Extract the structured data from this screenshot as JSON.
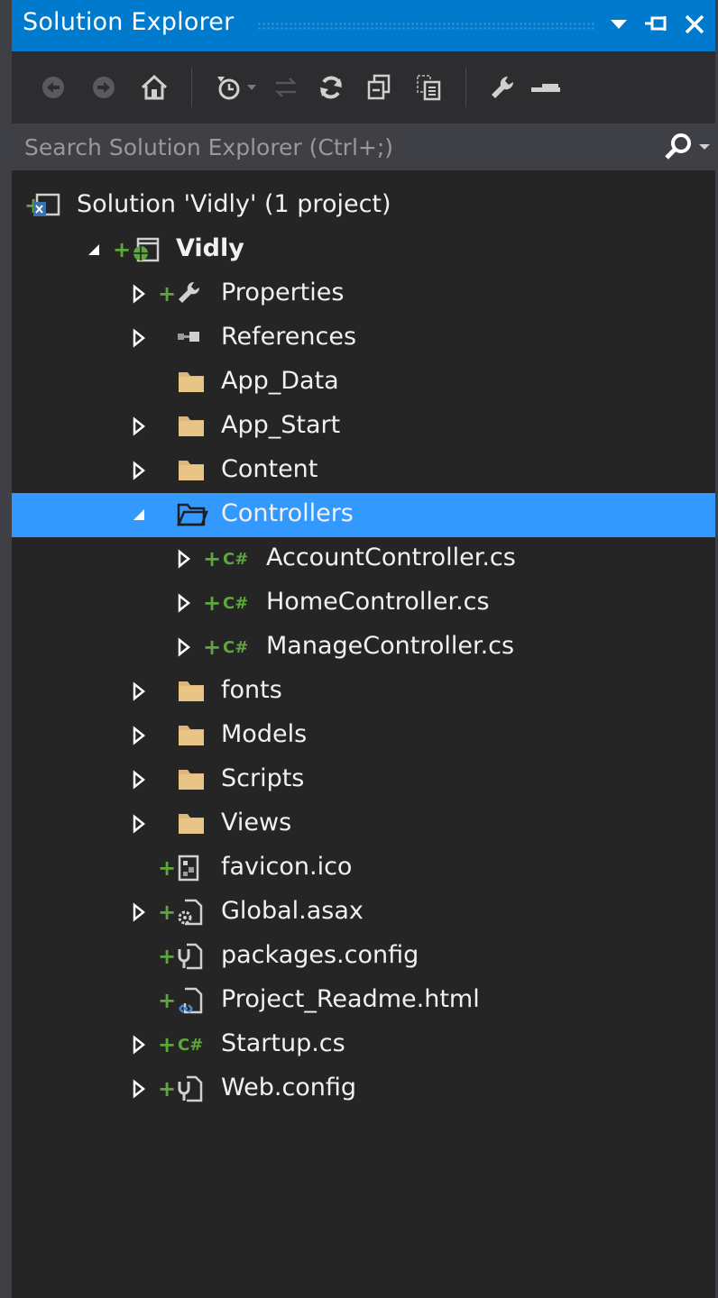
{
  "window": {
    "title": "Solution Explorer"
  },
  "titlebar_icons": [
    "dropdown-arrow-icon",
    "pin-icon",
    "close-icon"
  ],
  "toolbar": {
    "icons": [
      "back-icon",
      "forward-icon",
      "home-icon",
      "history-icon",
      "history-dropdown-icon",
      "sync-icon",
      "refresh-icon",
      "collapse-all-icon",
      "show-all-files-icon",
      "properties-wrench-icon",
      "preview-icon"
    ]
  },
  "search": {
    "placeholder": "Search Solution Explorer (Ctrl+;)"
  },
  "tree": {
    "items": [
      {
        "label": "Solution 'Vidly' (1 project)",
        "icon": "solution-icon",
        "expander": "none",
        "plus": true
      },
      {
        "label": "Vidly",
        "icon": "web-project-icon",
        "expander": "expanded",
        "plus": true,
        "bold": true
      },
      {
        "label": "Properties",
        "icon": "wrench-icon",
        "expander": "collapsed",
        "plus": true
      },
      {
        "label": "References",
        "icon": "references-icon",
        "expander": "collapsed",
        "plus": false
      },
      {
        "label": "App_Data",
        "icon": "folder-icon",
        "expander": "none",
        "plus": false
      },
      {
        "label": "App_Start",
        "icon": "folder-icon",
        "expander": "collapsed",
        "plus": false
      },
      {
        "label": "Content",
        "icon": "folder-icon",
        "expander": "collapsed",
        "plus": false
      },
      {
        "label": "Controllers",
        "icon": "folder-open-icon",
        "expander": "expanded",
        "plus": false,
        "selected": true
      },
      {
        "label": "AccountController.cs",
        "icon": "csharp-file-icon",
        "expander": "collapsed",
        "plus": true
      },
      {
        "label": "HomeController.cs",
        "icon": "csharp-file-icon",
        "expander": "collapsed",
        "plus": true
      },
      {
        "label": "ManageController.cs",
        "icon": "csharp-file-icon",
        "expander": "collapsed",
        "plus": true
      },
      {
        "label": "fonts",
        "icon": "folder-icon",
        "expander": "collapsed",
        "plus": false
      },
      {
        "label": "Models",
        "icon": "folder-icon",
        "expander": "collapsed",
        "plus": false
      },
      {
        "label": "Scripts",
        "icon": "folder-icon",
        "expander": "collapsed",
        "plus": false
      },
      {
        "label": "Views",
        "icon": "folder-icon",
        "expander": "collapsed",
        "plus": false
      },
      {
        "label": "favicon.ico",
        "icon": "image-file-icon",
        "expander": "none",
        "plus": true
      },
      {
        "label": "Global.asax",
        "icon": "asax-file-icon",
        "expander": "collapsed",
        "plus": true
      },
      {
        "label": "packages.config",
        "icon": "config-file-icon",
        "expander": "none",
        "plus": true
      },
      {
        "label": "Project_Readme.html",
        "icon": "html-file-icon",
        "expander": "none",
        "plus": true
      },
      {
        "label": "Startup.cs",
        "icon": "csharp-file-icon",
        "expander": "collapsed",
        "plus": true
      },
      {
        "label": "Web.config",
        "icon": "config-file-icon",
        "expander": "collapsed",
        "plus": true
      }
    ]
  },
  "colors": {
    "accent": "#007acc",
    "selection": "#3399ff",
    "background": "#252526",
    "text": "#f1f1f1",
    "plus_green": "#5ea63d",
    "folder": "#dcb67a"
  }
}
